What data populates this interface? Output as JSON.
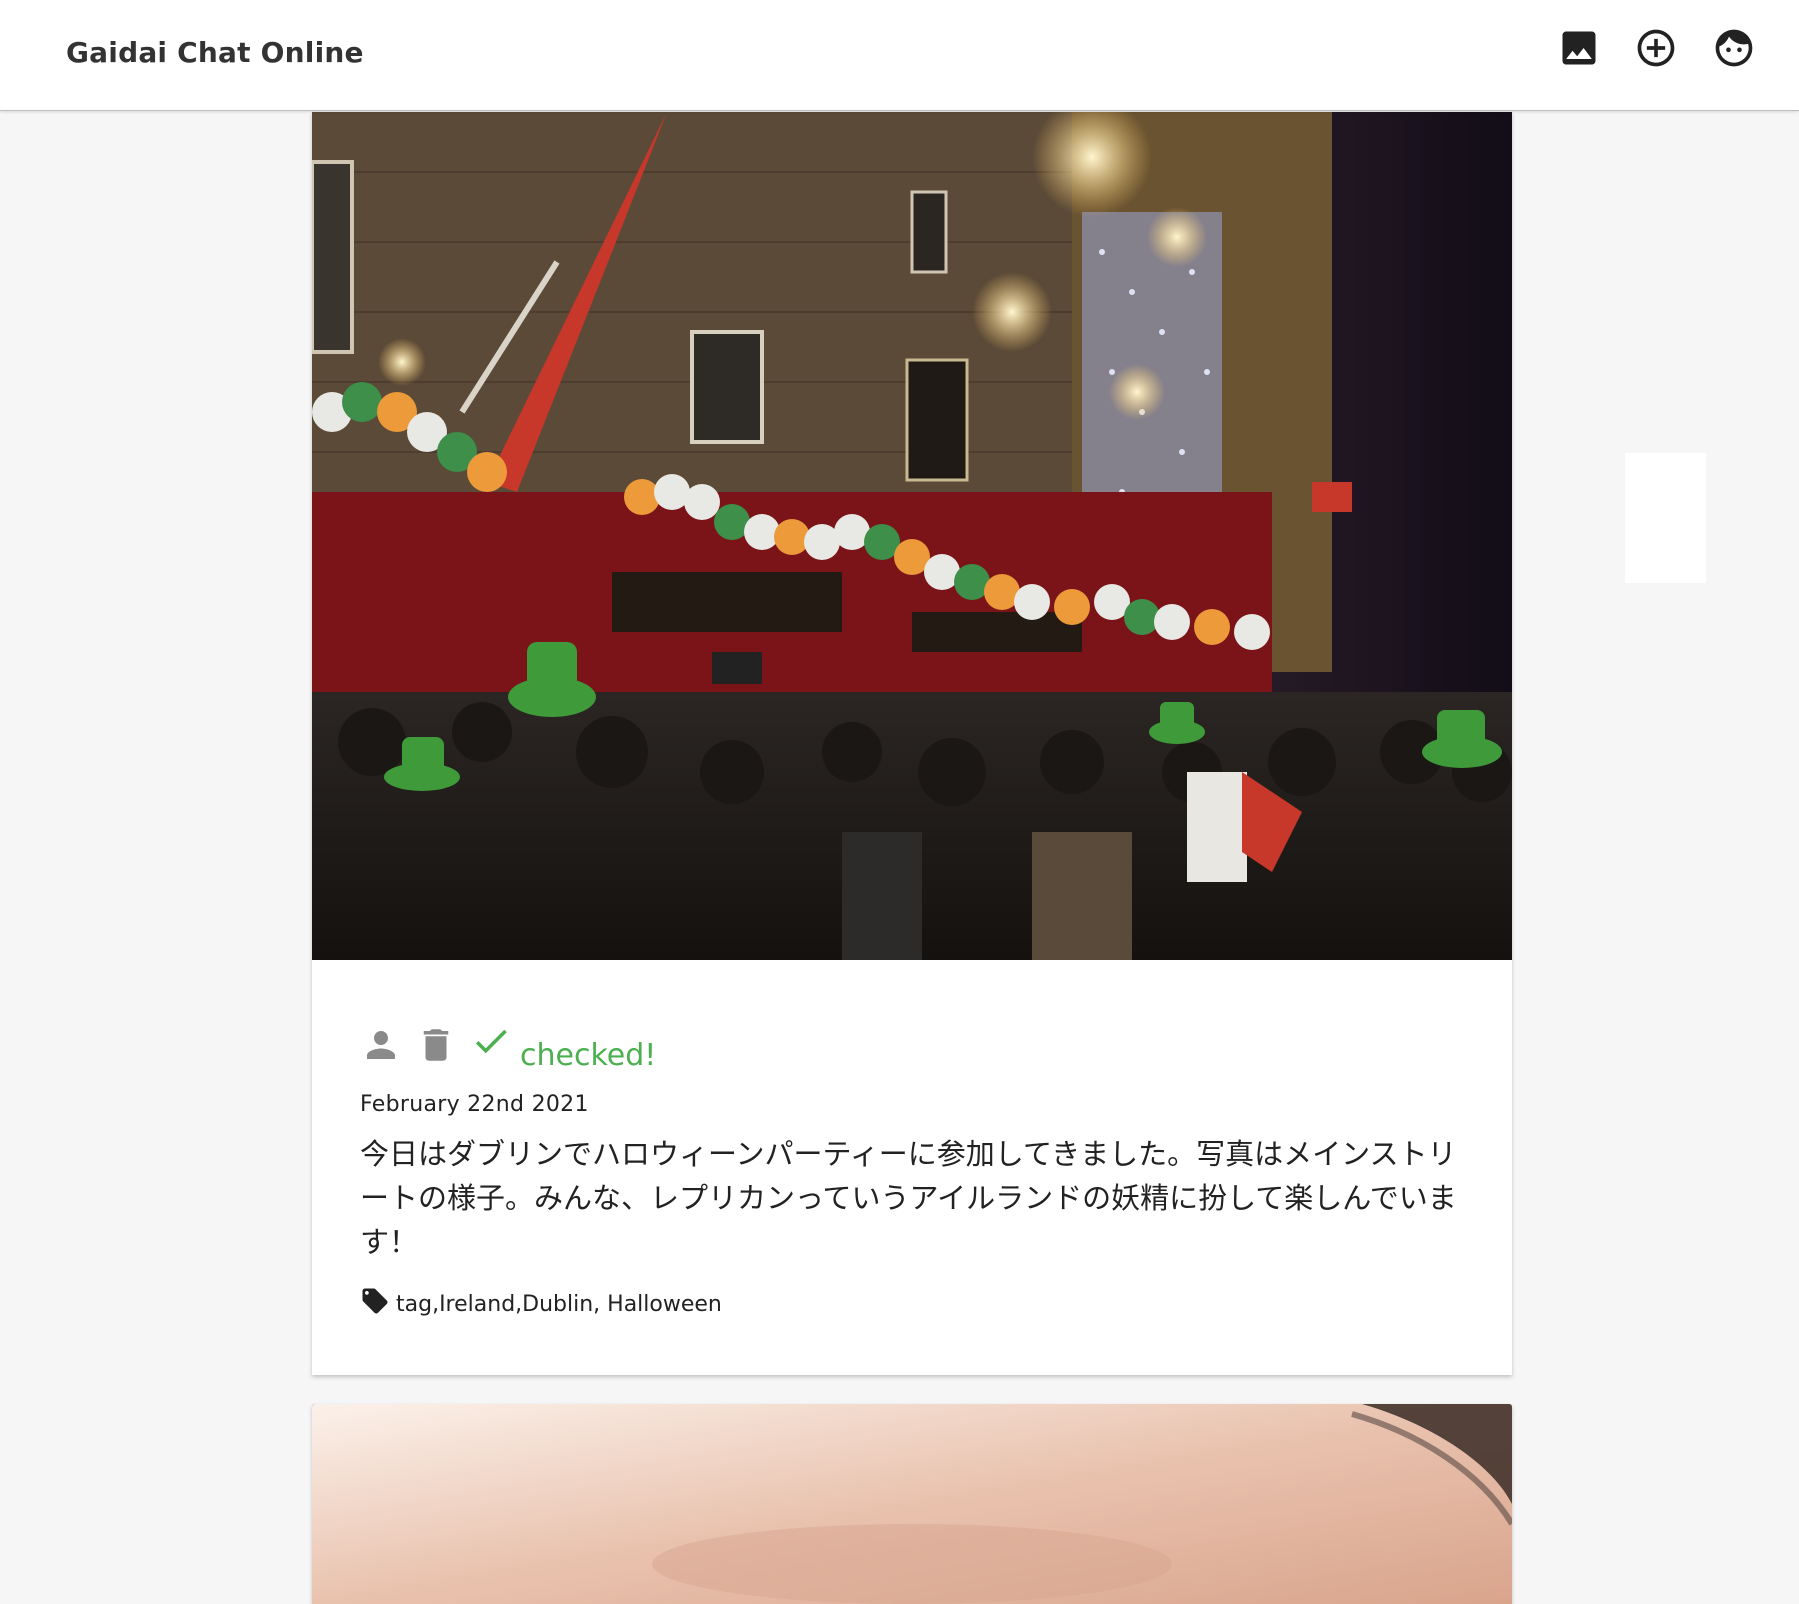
{
  "app": {
    "title": "Gaidai Chat Online"
  },
  "toolbar": {
    "icons": [
      "image-icon",
      "add-circle-icon",
      "face-icon"
    ]
  },
  "post": {
    "status_label": "checked!",
    "date": "February 22nd 2021",
    "text": "今日はダブリンでハロウィーンパーティーに参加してきました。写真はメインストリートの様子。みんな、レプリカンっていうアイルランドの妖精に扮して楽しんでいます！",
    "tags": "tag,Ireland,Dublin, Halloween",
    "action_icons": [
      "person-icon",
      "delete-icon",
      "check-icon"
    ]
  },
  "colors": {
    "accent_green": "#4caf50",
    "icon_gray": "#8a8a8a",
    "background": "#f6f6f6"
  }
}
